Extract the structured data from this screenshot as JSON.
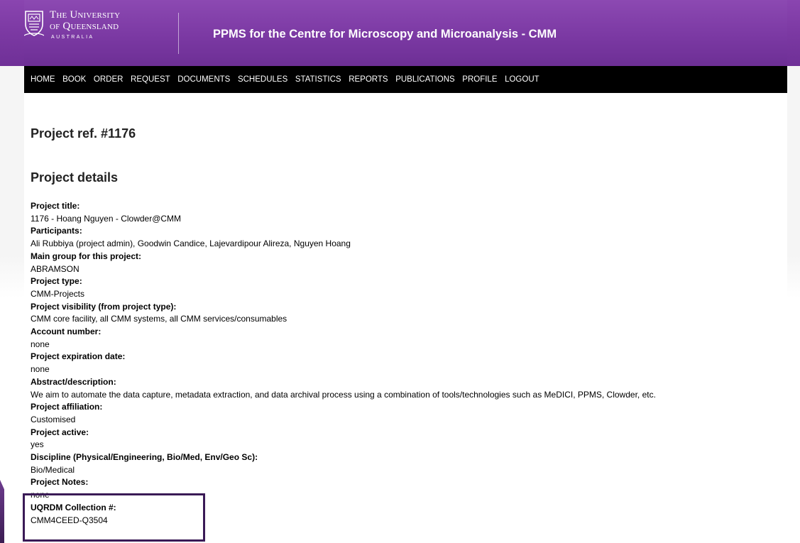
{
  "header": {
    "university_line1": "The University",
    "university_line2": "of Queensland",
    "university_line3": "AUSTRALIA",
    "app_title": "PPMS for the Centre for Microscopy and Microanalysis - CMM",
    "brand_color": "#7b39a3"
  },
  "nav": {
    "items": [
      {
        "label": "HOME"
      },
      {
        "label": "BOOK"
      },
      {
        "label": "ORDER"
      },
      {
        "label": "REQUEST"
      },
      {
        "label": "DOCUMENTS"
      },
      {
        "label": "SCHEDULES"
      },
      {
        "label": "STATISTICS"
      },
      {
        "label": "REPORTS"
      },
      {
        "label": "PUBLICATIONS"
      },
      {
        "label": "PROFILE"
      },
      {
        "label": "LOGOUT"
      }
    ]
  },
  "main": {
    "project_ref": "Project ref. #1176",
    "section_title": "Project details",
    "fields": [
      {
        "label": "Project title:",
        "value": "1176 - Hoang Nguyen - Clowder@CMM"
      },
      {
        "label": "Participants:",
        "value": "Ali Rubbiya (project admin), Goodwin Candice, Lajevardipour Alireza, Nguyen Hoang"
      },
      {
        "label": "Main group for this project:",
        "value": "ABRAMSON"
      },
      {
        "label": "Project type:",
        "value": "CMM-Projects"
      },
      {
        "label": "Project visibility (from project type):",
        "value": "CMM core facility, all CMM systems, all CMM services/consumables"
      },
      {
        "label": "Account number:",
        "value": "none"
      },
      {
        "label": "Project expiration date:",
        "value": "none"
      },
      {
        "label": "Abstract/description:",
        "value": "We aim to automate the data capture, metadata extraction, and data archival process using a combination of tools/technologies such as MeDICI, PPMS, Clowder, etc."
      },
      {
        "label": "Project affiliation:",
        "value": "Customised"
      },
      {
        "label": "Project active:",
        "value": "yes"
      },
      {
        "label": "Discipline (Physical/Engineering, Bio/Med, Env/Geo Sc):",
        "value": "Bio/Medical"
      },
      {
        "label": "Project Notes:",
        "value": "none"
      },
      {
        "label": "UQRDM Collection #:",
        "value": "CMM4CEED-Q3504"
      }
    ]
  }
}
